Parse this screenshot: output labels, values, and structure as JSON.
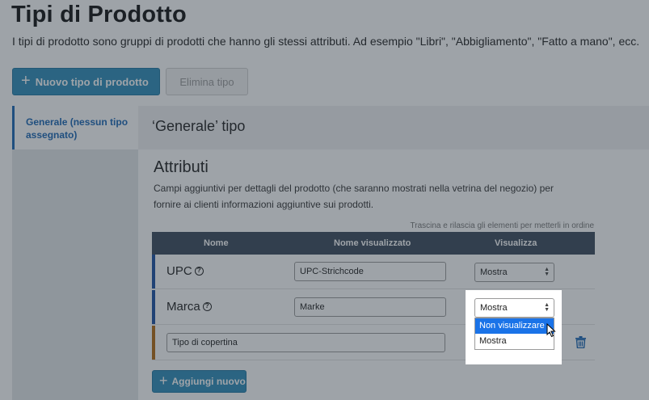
{
  "header": {
    "title": "Tipi di Prodotto",
    "description": "I tipi di prodotto sono gruppi di prodotti che hanno gli stessi attributi. Ad esempio \"Libri\", \"Abbigliamento\", \"Fatto a mano\", ecc."
  },
  "toolbar": {
    "new_label": "Nuovo tipo di prodotto",
    "delete_label": "Elimina tipo"
  },
  "sidebar": {
    "items": [
      {
        "label": "Generale (nessun tipo assegnato)",
        "active": true
      }
    ]
  },
  "main": {
    "type_title": "‘Generale’ tipo",
    "section_title": "Attributi",
    "section_desc": "Campi aggiuntivi per dettagli del prodotto (che saranno mostrati nella vetrina del negozio) per fornire ai clienti informazioni aggiuntive sui prodotti.",
    "drag_hint": "Trascina e rilascia gli elementi per metterli in ordine",
    "columns": [
      "Nome",
      "Nome visualizzato",
      "Visualizza"
    ],
    "rows": [
      {
        "name": "UPC",
        "display_name": "UPC-Strichcode",
        "visibility": "Mostra",
        "bar_color": "#1a4fa3"
      },
      {
        "name": "Marca",
        "display_name": "Marke",
        "visibility": "Mostra",
        "bar_color": "#1a4fa3"
      },
      {
        "name": "",
        "name_input": "Tipo di copertina",
        "display_name": "",
        "visibility": "Mostra",
        "bar_color": "#b36b12"
      }
    ],
    "add_label": "Aggiungi nuovo"
  },
  "dropdown": {
    "options": [
      "Non visualizzare",
      "Mostra"
    ],
    "highlighted": "Non visualizzare"
  },
  "colors": {
    "accent": "#2f8dba",
    "link": "#1a66b5",
    "table_header": "#3b4a5c",
    "selection": "#1a73e8"
  }
}
